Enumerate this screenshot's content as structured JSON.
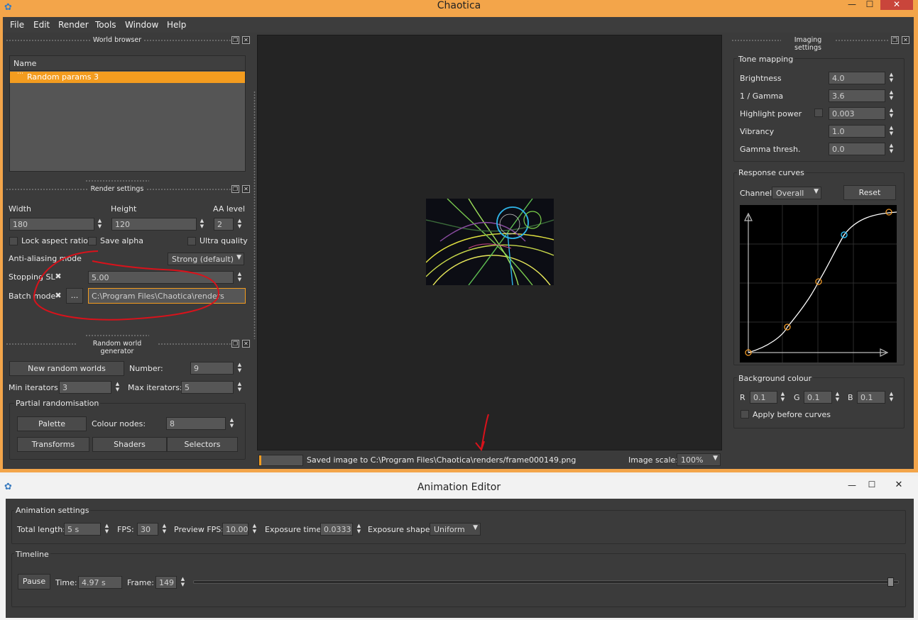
{
  "main_window": {
    "title": "Chaotica",
    "menu": [
      "File",
      "Edit",
      "Render",
      "Tools",
      "Window",
      "Help"
    ]
  },
  "world_browser": {
    "title": "World browser",
    "column_header": "Name",
    "items": [
      "Random params 3"
    ]
  },
  "render_settings": {
    "title": "Render settings",
    "width_label": "Width",
    "height_label": "Height",
    "aa_label": "AA level",
    "width_value": "180",
    "height_value": "120",
    "aa_value": "2",
    "lock_aspect_label": "Lock aspect ratio",
    "save_alpha_label": "Save alpha",
    "ultra_quality_label": "Ultra quality",
    "aa_mode_label": "Anti-aliasing mode",
    "aa_mode_value": "Strong (default)",
    "stopping_label": "Stopping SL",
    "stopping_value": "5.00",
    "batch_label": "Batch mode",
    "browse_label": "...",
    "batch_path": "C:\\Program Files\\Chaotica\\renders"
  },
  "random_world_generator": {
    "title": "Random world generator",
    "new_worlds_label": "New random worlds",
    "number_label": "Number:",
    "number_value": "9",
    "min_iter_label": "Min iterators:",
    "min_iter_value": "3",
    "max_iter_label": "Max iterators:",
    "max_iter_value": "5",
    "partial_title": "Partial randomisation",
    "palette_label": "Palette",
    "colour_nodes_label": "Colour nodes:",
    "colour_nodes_value": "8",
    "transforms_label": "Transforms",
    "shaders_label": "Shaders",
    "selectors_label": "Selectors"
  },
  "status": {
    "progress": 0.05,
    "message": "Saved image to C:\\Program Files\\Chaotica\\renders/frame000149.png",
    "image_scale_label": "Image scale:",
    "image_scale_value": "100%"
  },
  "imaging_settings": {
    "title": "Imaging settings",
    "tone_mapping_title": "Tone mapping",
    "rows": [
      {
        "label": "Brightness",
        "value": "4.0"
      },
      {
        "label": "1 / Gamma",
        "value": "3.6"
      },
      {
        "label": "Highlight power",
        "value": "0.003"
      },
      {
        "label": "Vibrancy",
        "value": "1.0"
      },
      {
        "label": "Gamma thresh.",
        "value": "0.0"
      }
    ],
    "response_curves_title": "Response curves",
    "channel_label": "Channel:",
    "channel_value": "Overall",
    "reset_label": "Reset",
    "background_title": "Background colour",
    "r_label": "R",
    "r_value": "0.1",
    "g_label": "G",
    "g_value": "0.1",
    "b_label": "B",
    "b_value": "0.1",
    "apply_before_label": "Apply before curves"
  },
  "animation_editor": {
    "title": "Animation Editor",
    "settings_title": "Animation settings",
    "total_length_label": "Total length:",
    "total_length_value": "5 s",
    "fps_label": "FPS:",
    "fps_value": "30",
    "preview_fps_label": "Preview FPS:",
    "preview_fps_value": "10.00",
    "exposure_time_label": "Exposure time:",
    "exposure_time_value": "0.0333 s",
    "exposure_shape_label": "Exposure shape:",
    "exposure_shape_value": "Uniform",
    "timeline_title": "Timeline",
    "pause_label": "Pause",
    "time_label": "Time:",
    "time_value": "4.97 s",
    "frame_label": "Frame:",
    "frame_value": "149",
    "timeline_position": 0.994
  },
  "colors": {
    "title_bar": "#f3a54a",
    "panel_bg": "#3b3b3b",
    "selection": "#f39c1f",
    "annotation": "#d9121b",
    "curve_accent": "#f09a28",
    "curve_selected": "#2fb4e8"
  }
}
